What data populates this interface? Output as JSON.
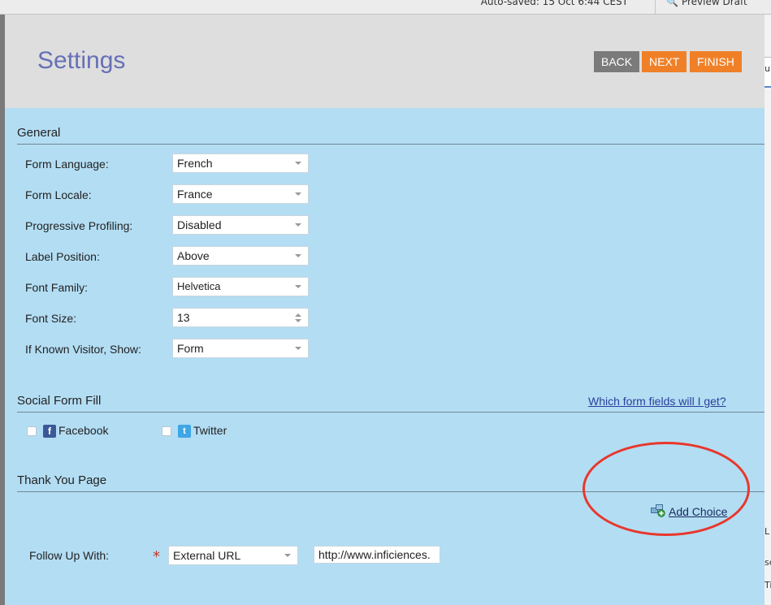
{
  "background": {
    "autosave_text": "Auto-saved: 15 Oct 6:44 CEST",
    "preview_label": "Preview Draft",
    "right_fragments": [
      "u",
      "L",
      "se",
      "Ti"
    ]
  },
  "modal": {
    "title": "Settings",
    "buttons": {
      "back": "BACK",
      "next": "NEXT",
      "finish": "FINISH"
    }
  },
  "general": {
    "heading": "General",
    "rows": [
      {
        "label": "Form Language:",
        "value": "French"
      },
      {
        "label": "Form Locale:",
        "value": "France"
      },
      {
        "label": "Progressive Profiling:",
        "value": "Disabled"
      },
      {
        "label": "Label Position:",
        "value": "Above"
      },
      {
        "label": "Font Family:",
        "value": "Helvetica"
      },
      {
        "label": "Font Size:",
        "value": "13"
      },
      {
        "label": "If Known Visitor, Show:",
        "value": "Form"
      }
    ]
  },
  "social": {
    "heading": "Social Form Fill",
    "link": "Which form fields will I get?",
    "facebook_label": "Facebook",
    "twitter_label": "Twitter"
  },
  "thank_you": {
    "heading": "Thank You Page",
    "add_choice": "Add Choice",
    "follow_up_label": "Follow Up With:",
    "required_mark": "*",
    "follow_up_value": "External URL",
    "url_value": "http://www.inficiences."
  },
  "colors": {
    "modal_bg": "#b3ddf3",
    "header_bg": "#dedede",
    "title": "#6670b6",
    "accent_orange": "#f08028",
    "back_gray": "#7b7b7b",
    "highlight_circle": "#e8372c"
  }
}
